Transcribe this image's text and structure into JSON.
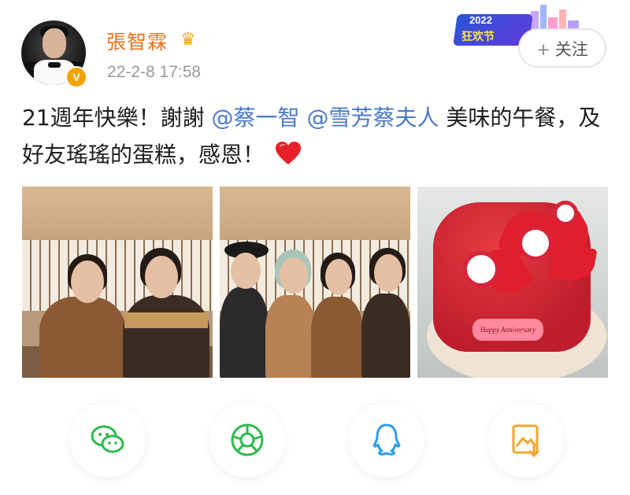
{
  "post": {
    "author": "張智霖",
    "timestamp": "22-2-8 17:58",
    "verified_badge": "V",
    "text_part1": "21週年快樂！謝謝",
    "mention1": "@蔡一智",
    "mention2": "@雪芳蔡夫人",
    "text_part2": "美味的午餐，及好友瑤瑤的蛋糕，感恩！",
    "emoji": "heart-icon"
  },
  "banner": {
    "year": "2022",
    "slogan": "狂欢节"
  },
  "follow_button": {
    "plus": "+",
    "label": "关注"
  },
  "photos": [
    {
      "name": "photo-couple"
    },
    {
      "name": "photo-group"
    },
    {
      "name": "photo-cake",
      "plaque": "Happy Anniversary"
    }
  ],
  "share_icons": [
    {
      "icon": "wechat-icon",
      "color": "#2dbb4e"
    },
    {
      "icon": "moments-icon",
      "color": "#2dbb4e"
    },
    {
      "icon": "qq-icon",
      "color": "#2d9ef0"
    },
    {
      "icon": "save-image-icon",
      "color": "#f3a72c"
    }
  ],
  "colors": {
    "author": "#e8711a",
    "mention": "#4a78c8",
    "timestamp": "#9a9a9a"
  }
}
